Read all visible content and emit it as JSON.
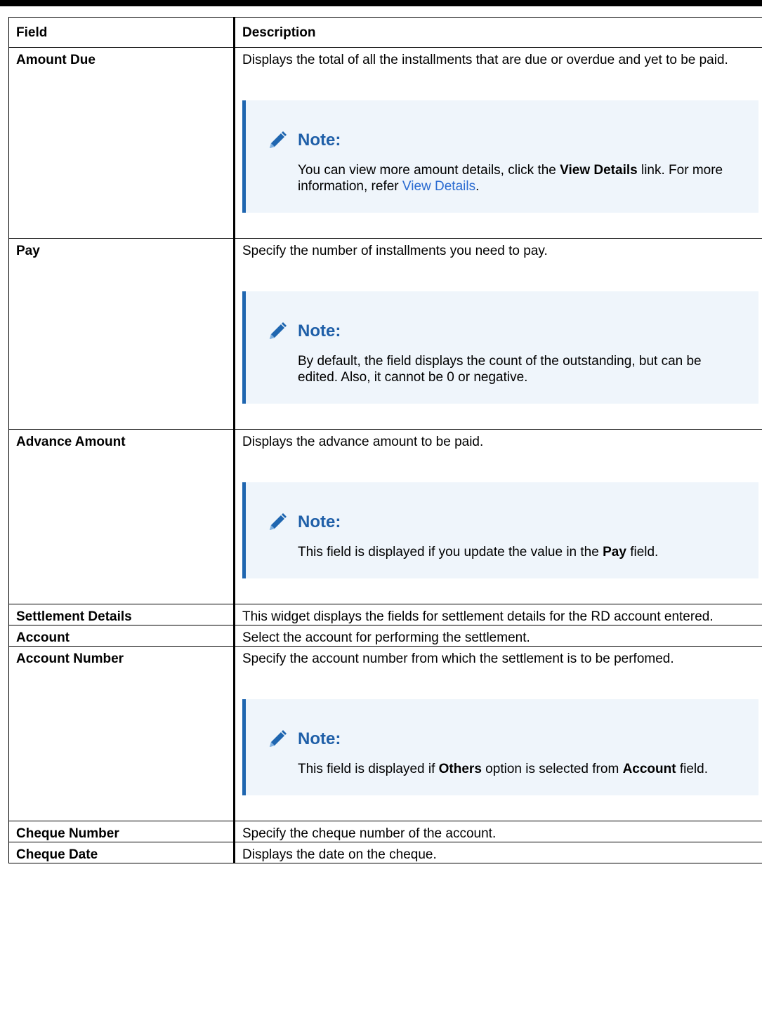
{
  "table": {
    "headers": [
      "Field",
      "Description"
    ],
    "rows": [
      {
        "field": "Amount Due",
        "description": "Displays the total of all the installments that are due or overdue and yet to be paid.",
        "note": {
          "title": "Note:",
          "parts": [
            {
              "text": "You can view more amount details, click the ",
              "style": "normal"
            },
            {
              "text": "View Details",
              "style": "bold"
            },
            {
              "text": " link. For more information, refer ",
              "style": "normal"
            },
            {
              "text": "View Details",
              "style": "link"
            },
            {
              "text": ".",
              "style": "normal"
            }
          ]
        }
      },
      {
        "field": "Pay",
        "description": "Specify the number of installments you need to pay.",
        "note": {
          "title": "Note:",
          "parts": [
            {
              "text": "By default, the field displays the count of the outstanding, but can be edited. Also, it cannot be 0 or negative.",
              "style": "normal"
            }
          ]
        }
      },
      {
        "field": "Advance Amount",
        "description": "Displays the advance amount to be paid.",
        "note": {
          "title": "Note:",
          "parts": [
            {
              "text": "This field is displayed if you update the value in the ",
              "style": "normal"
            },
            {
              "text": "Pay",
              "style": "bold"
            },
            {
              "text": " field.",
              "style": "normal"
            }
          ]
        }
      },
      {
        "field": "Settlement Details",
        "description": "This widget displays the fields for settlement details for the RD account entered.",
        "note": null
      },
      {
        "field": "Account",
        "description": "Select the account for performing the settlement.",
        "note": null
      },
      {
        "field": "Account Number",
        "description": "Specify the account number from which the settlement is to be perfomed.",
        "note": {
          "title": "Note:",
          "parts": [
            {
              "text": "This field is displayed if ",
              "style": "normal"
            },
            {
              "text": "Others",
              "style": "bold"
            },
            {
              "text": " option is selected from ",
              "style": "normal"
            },
            {
              "text": "Account",
              "style": "bold"
            },
            {
              "text": " field.",
              "style": "normal"
            }
          ]
        }
      },
      {
        "field": "Cheque Number",
        "description": "Specify the cheque number of the account.",
        "note": null
      },
      {
        "field": "Cheque Date",
        "description": "Displays the date on the cheque.",
        "note": null
      }
    ]
  },
  "icons": {
    "note_icon": "pencil-icon"
  },
  "colors": {
    "note_background": "#eff5fb",
    "note_accent": "#1f66b0",
    "note_title": "#1f5fa8",
    "link": "#2a6bd1"
  }
}
